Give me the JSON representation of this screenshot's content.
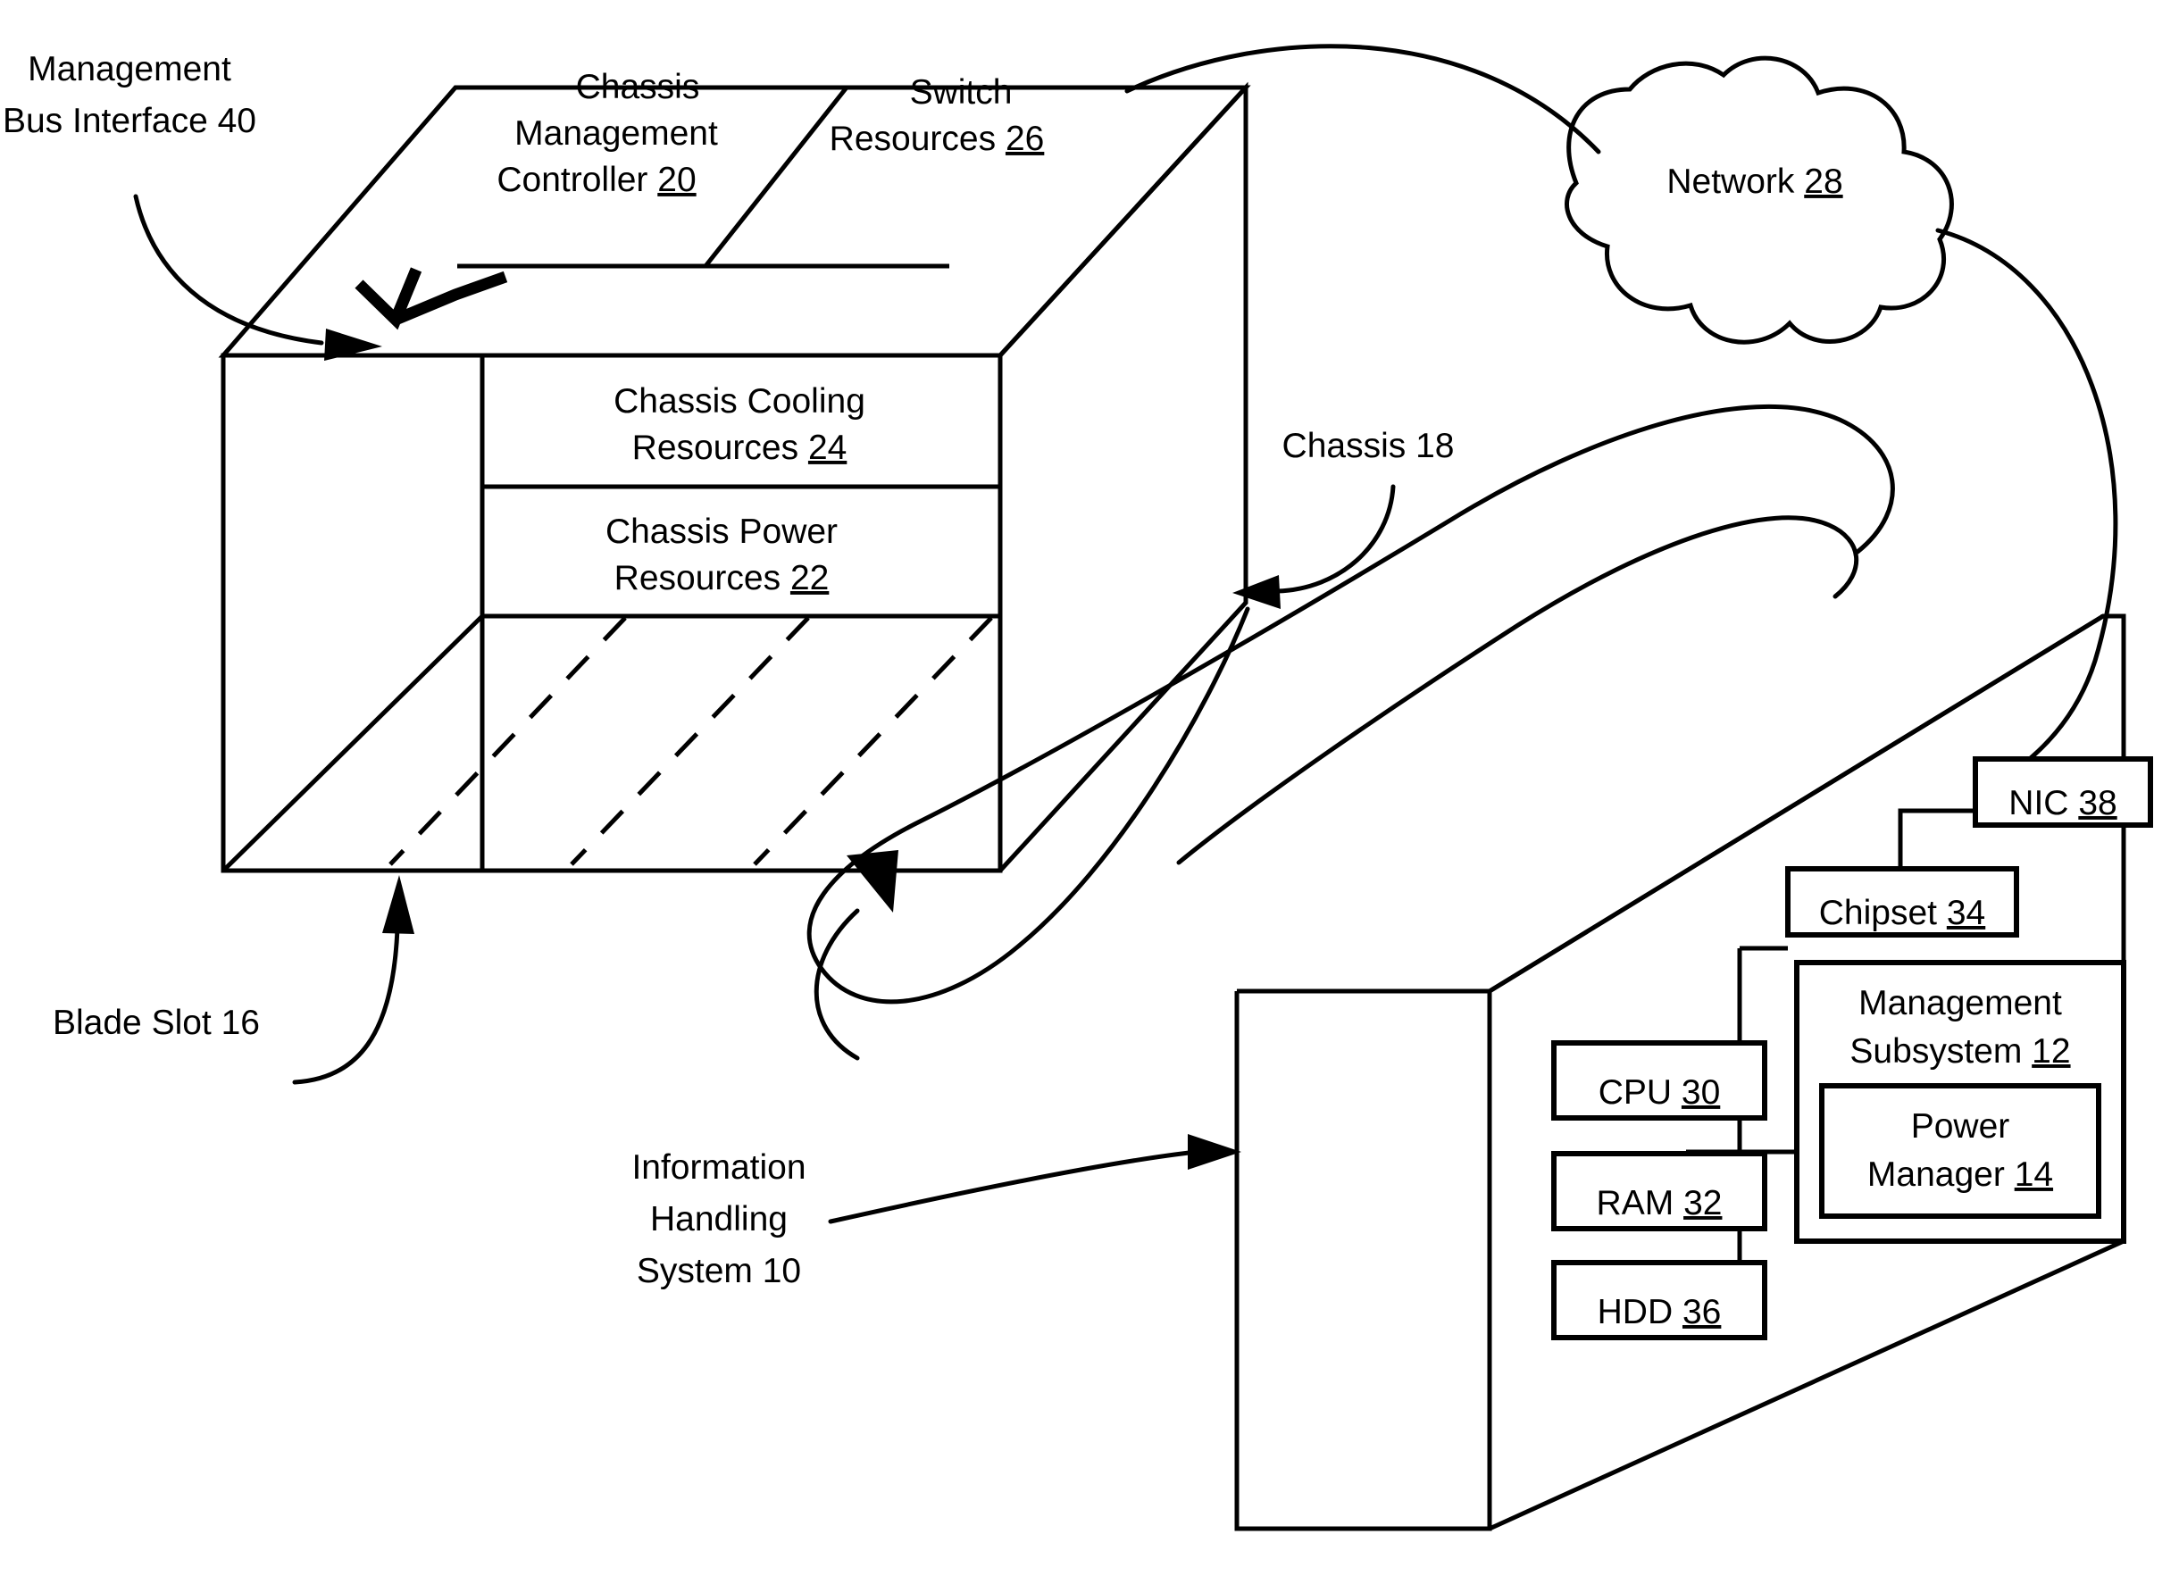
{
  "figure": {
    "type": "patent-block-diagram",
    "title": "Information handling system and blade chassis management diagram"
  },
  "chassis": {
    "label": "Chassis 18",
    "ref": "18",
    "top_face_cells": [
      {
        "name": "chassis-management-controller",
        "lines": [
          "Chassis",
          "Management",
          "Controller"
        ],
        "ref": "20"
      },
      {
        "name": "switch-resources",
        "lines": [
          "Switch",
          "Resources"
        ],
        "ref": "26"
      }
    ],
    "front_face_cells": [
      {
        "name": "chassis-cooling-resources",
        "lines": [
          "Chassis Cooling",
          "Resources"
        ],
        "ref": "24"
      },
      {
        "name": "chassis-power-resources",
        "lines": [
          "Chassis Power",
          "Resources"
        ],
        "ref": "22"
      }
    ]
  },
  "management_bus_interface": {
    "label_lines": [
      "Management",
      "Bus Interface 40"
    ],
    "ref": "40"
  },
  "blade_slot": {
    "label": "Blade Slot 16",
    "ref": "16"
  },
  "network": {
    "label": "Network",
    "ref": "28"
  },
  "information_handling_system": {
    "label_lines": [
      "Information",
      "Handling",
      "System 10"
    ],
    "ref": "10",
    "components": [
      {
        "name": "cpu",
        "label": "CPU",
        "ref": "30"
      },
      {
        "name": "ram",
        "label": "RAM",
        "ref": "32"
      },
      {
        "name": "hdd",
        "label": "HDD",
        "ref": "36"
      },
      {
        "name": "chipset",
        "label": "Chipset",
        "ref": "34"
      },
      {
        "name": "nic",
        "label": "NIC",
        "ref": "38"
      }
    ],
    "management_subsystem": {
      "lines": [
        "Management",
        "Subsystem"
      ],
      "ref": "12",
      "power_manager": {
        "lines": [
          "Power",
          "Manager"
        ],
        "ref": "14"
      }
    }
  },
  "colors": {
    "stroke": "#000000",
    "background": "#ffffff"
  }
}
